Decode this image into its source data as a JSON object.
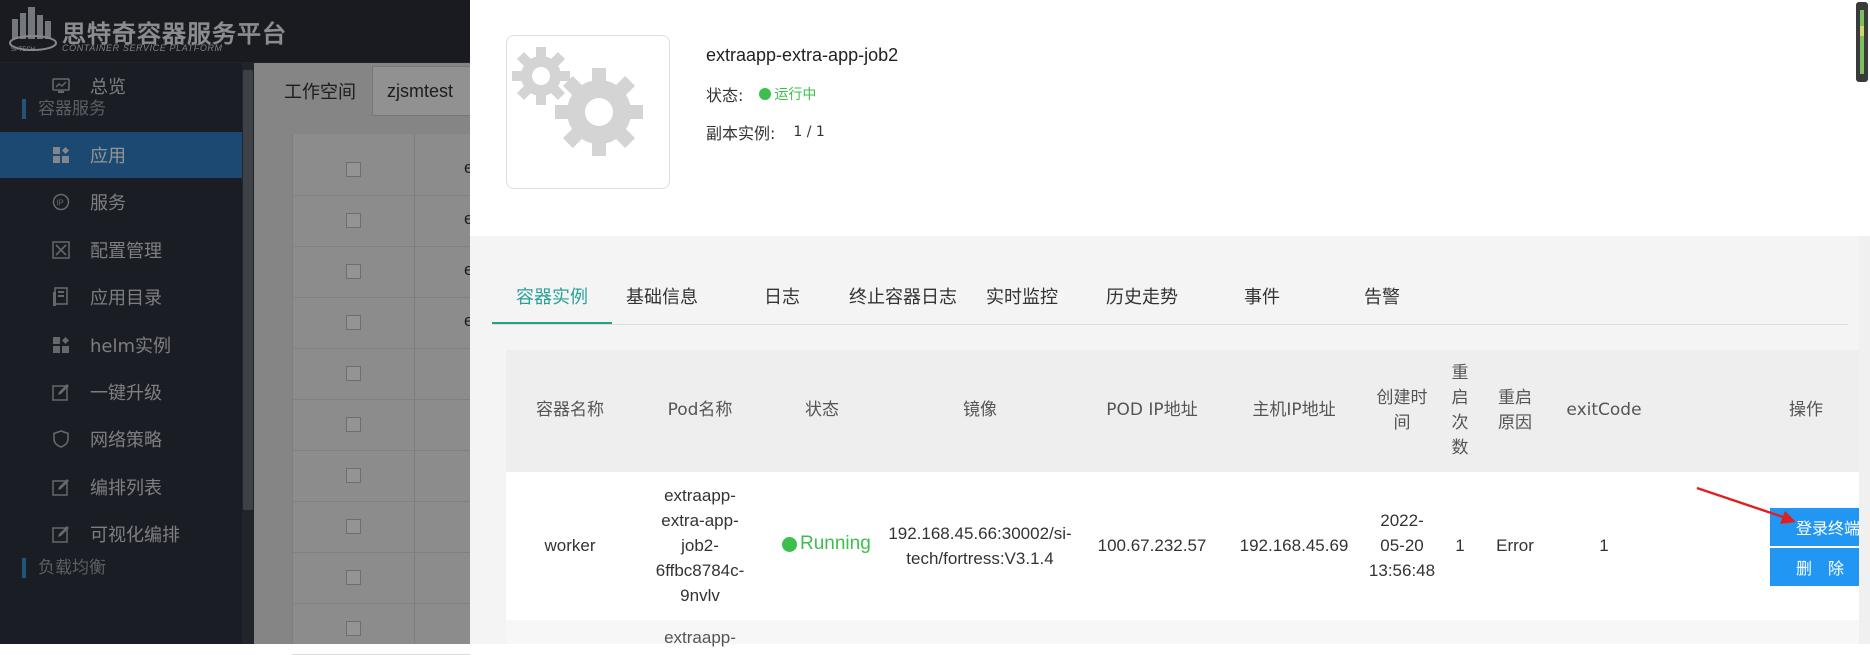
{
  "header": {
    "logo_mark_text": "SI-TECH",
    "title_cn": "思特奇容器服务平台",
    "title_en": "CONTAINER SERVICE PLATFORM"
  },
  "sidebar": {
    "items": [
      {
        "label": "总览",
        "icon": "monitor-icon",
        "active": false
      },
      {
        "label": "应用",
        "icon": "apps-icon",
        "active": true
      },
      {
        "label": "服务",
        "icon": "ip-icon",
        "active": false
      },
      {
        "label": "配置管理",
        "icon": "tools-icon",
        "active": false
      },
      {
        "label": "应用目录",
        "icon": "catalog-icon",
        "active": false
      },
      {
        "label": "helm实例",
        "icon": "apps-icon",
        "active": false
      },
      {
        "label": "一键升级",
        "icon": "edit-icon",
        "active": false
      },
      {
        "label": "网络策略",
        "icon": "shield-icon",
        "active": false
      },
      {
        "label": "编排列表",
        "icon": "edit-icon",
        "active": false
      },
      {
        "label": "可视化编排",
        "icon": "edit-icon",
        "active": false
      }
    ],
    "groups": [
      "容器服务",
      "负载均衡"
    ]
  },
  "background": {
    "workspace_label": "工作空间",
    "workspace_value": "zjsmtest",
    "row_letter": "e"
  },
  "drawer": {
    "app_name": "extraapp-extra-app-job2",
    "status_label": "状态:",
    "status_value": "运行中",
    "replica_label": "副本实例:",
    "replica_value": "1 / 1",
    "tabs": [
      "容器实例",
      "基础信息",
      "日志",
      "终止容器日志",
      "实时监控",
      "历史走势",
      "事件",
      "告警"
    ],
    "active_tab": "容器实例",
    "columns": {
      "container_name": "容器名称",
      "pod_name": "Pod名称",
      "status": "状态",
      "image": "镜像",
      "pod_ip": "POD IP地址",
      "host_ip": "主机IP地址",
      "created_1": "创建时",
      "created_2": "间",
      "restart_count_1": "重",
      "restart_count_2": "启",
      "restart_count_3": "次",
      "restart_count_4": "数",
      "restart_reason_1": "重启",
      "restart_reason_2": "原因",
      "exit_code": "exitCode",
      "actions": "操作"
    },
    "rows": [
      {
        "container_name": "worker",
        "pod_name_lines": [
          "extraapp-",
          "extra-app-",
          "job2-",
          "6ffbc8784c-",
          "9nvlv"
        ],
        "status": "Running",
        "image_lines": [
          "192.168.45.66:30002/si-",
          "tech/fortress:V3.1.4"
        ],
        "pod_ip": "100.67.232.57",
        "host_ip": "192.168.45.69",
        "created_lines": [
          "2022-",
          "05-20",
          "13:56:48"
        ],
        "restart_count": "1",
        "restart_reason": "Error",
        "exit_code": "1"
      }
    ],
    "next_row_partial": "extraapp-",
    "buttons": {
      "terminal": "登录终端",
      "delete": "删　除"
    }
  },
  "colors": {
    "accent_blue": "#2196f3",
    "sidebar_active": "#2f7fc3",
    "running_green": "#3cbf4d",
    "tab_active": "#22a382",
    "arrow_red": "#e02020"
  }
}
